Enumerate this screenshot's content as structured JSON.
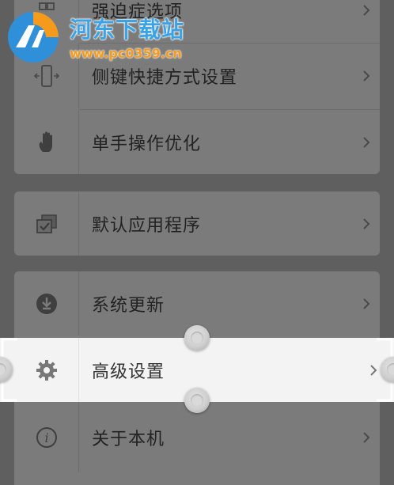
{
  "settings": {
    "group1": {
      "items": [
        {
          "label": "强迫症选项",
          "icon": "grid-icon"
        },
        {
          "label": "侧键快捷方式设置",
          "icon": "side-key-icon"
        },
        {
          "label": "单手操作优化",
          "icon": "hand-icon"
        }
      ]
    },
    "group2": {
      "items": [
        {
          "label": "默认应用程序",
          "icon": "checked-windows-icon"
        }
      ]
    },
    "group3": {
      "items": [
        {
          "label": "系统更新",
          "icon": "download-icon"
        },
        {
          "label": "高级设置",
          "icon": "gear-icon"
        },
        {
          "label": "关于本机",
          "icon": "info-icon"
        }
      ]
    }
  },
  "watermark": {
    "title": "河东下载站",
    "url": "www.pc0359.cn"
  },
  "colors": {
    "dim_overlay_bg": "#5f5f5f",
    "card_bg": "#7b7b7b",
    "highlight_bg": "#f3f3f3",
    "watermark_blue": "#39a3e6",
    "watermark_orange": "#f59a1a"
  }
}
